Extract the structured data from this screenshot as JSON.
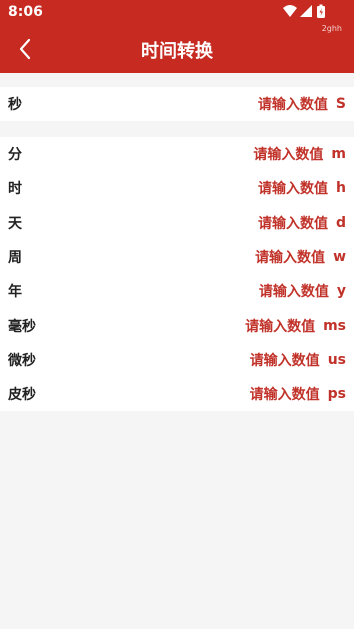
{
  "status_bar": {
    "time": "8:06",
    "sub_text": "2ghh",
    "icons": [
      "wifi-icon",
      "signal-icon",
      "battery-icon"
    ]
  },
  "header": {
    "title": "时间转换",
    "back_icon": "chevron-left-icon"
  },
  "colors": {
    "accent": "#c62a21",
    "input_text": "#c1332a",
    "background": "#f5f5f5"
  },
  "seconds_row": {
    "label": "秒",
    "placeholder": "请输入数值",
    "unit": "S"
  },
  "rows": [
    {
      "label": "分",
      "placeholder": "请输入数值",
      "unit": "m"
    },
    {
      "label": "时",
      "placeholder": "请输入数值",
      "unit": "h"
    },
    {
      "label": "天",
      "placeholder": "请输入数值",
      "unit": "d"
    },
    {
      "label": "周",
      "placeholder": "请输入数值",
      "unit": "w"
    },
    {
      "label": "年",
      "placeholder": "请输入数值",
      "unit": "y"
    },
    {
      "label": "毫秒",
      "placeholder": "请输入数值",
      "unit": "ms"
    },
    {
      "label": "微秒",
      "placeholder": "请输入数值",
      "unit": "us"
    },
    {
      "label": "皮秒",
      "placeholder": "请输入数值",
      "unit": "ps"
    }
  ]
}
